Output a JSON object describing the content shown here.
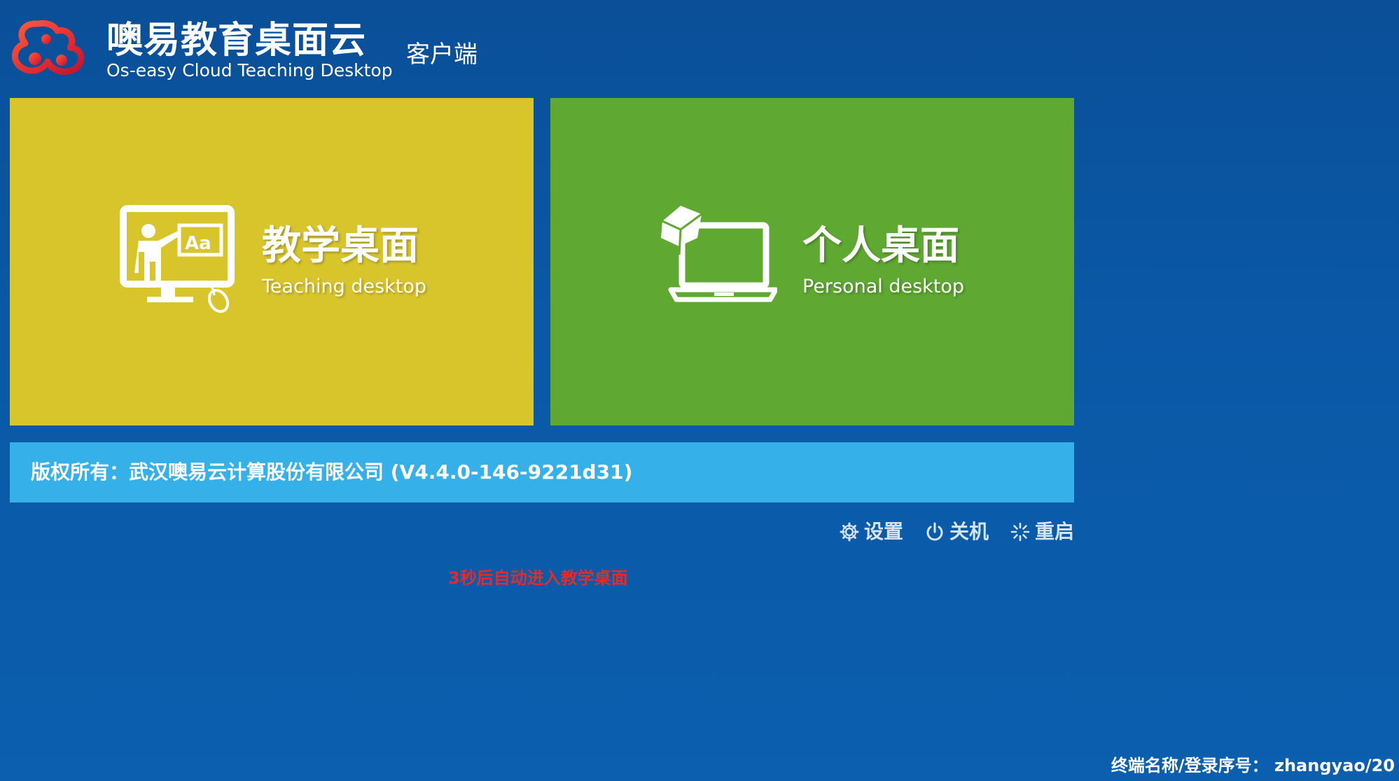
{
  "header": {
    "brand_title": "噢易教育桌面云",
    "brand_subtitle": "Os-easy Cloud Teaching Desktop",
    "client_label": "客户端"
  },
  "tiles": [
    {
      "title": "教学桌面",
      "subtitle": "Teaching desktop",
      "color": "#d8c52c",
      "icon": "teacher-monitor-icon"
    },
    {
      "title": "个人桌面",
      "subtitle": "Personal desktop",
      "color": "#5fa832",
      "icon": "laptop-icon"
    }
  ],
  "footer": {
    "copyright": "版权所有：武汉噢易云计算股份有限公司 (V4.4.0-146-9221d31)"
  },
  "actions": {
    "settings": {
      "label": "设置",
      "icon": "gear-icon"
    },
    "shutdown": {
      "label": "关机",
      "icon": "power-icon"
    },
    "restart": {
      "label": "重启",
      "icon": "spinner-icon"
    }
  },
  "countdown": "3秒后自动进入教学桌面",
  "terminal": "终端名称/登录序号： zhangyao/20",
  "colors": {
    "background": "#0a58a6",
    "copyright_bar": "#35b0e8",
    "countdown_text": "#e52a2a"
  }
}
